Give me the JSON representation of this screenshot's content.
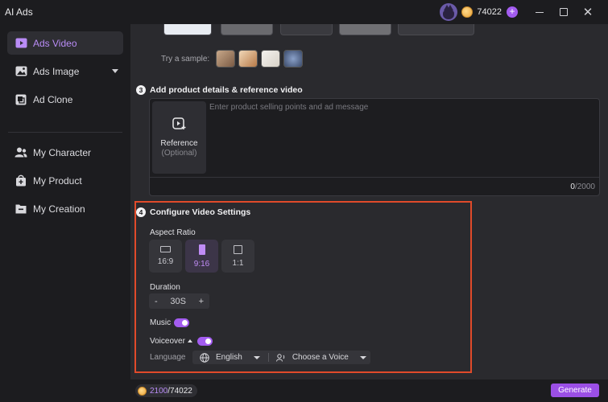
{
  "app": {
    "title": "AI Ads"
  },
  "header": {
    "credits": "74022"
  },
  "sidebar": {
    "items": [
      {
        "label": "Ads Video",
        "icon": "video-play-icon",
        "active": true
      },
      {
        "label": "Ads Image",
        "icon": "image-icon",
        "active": false
      },
      {
        "label": "Ad Clone",
        "icon": "ad-clone-icon",
        "active": false
      },
      {
        "label": "My Character",
        "icon": "character-icon",
        "active": false
      },
      {
        "label": "My Product",
        "icon": "product-icon",
        "active": false
      },
      {
        "label": "My Creation",
        "icon": "folder-icon",
        "active": false
      }
    ]
  },
  "samples": {
    "label": "Try a sample:"
  },
  "details": {
    "step_number": "3",
    "heading": "Add product details & reference video",
    "placeholder": "Enter product selling points and ad message",
    "reference_title": "Reference",
    "reference_optional": "(Optional)",
    "char_count_current": "0",
    "char_count_max": "/2000"
  },
  "config": {
    "step_number": "4",
    "heading": "Configure Video Settings",
    "aspect_ratio_label": "Aspect Ratio",
    "aspect_ratios": [
      {
        "label": "16:9",
        "selected": false
      },
      {
        "label": "9:16",
        "selected": true
      },
      {
        "label": "1:1",
        "selected": false
      }
    ],
    "duration_label": "Duration",
    "duration_minus": "-",
    "duration_value": "30S",
    "duration_plus": "+",
    "music_label": "Music",
    "music_on": true,
    "voiceover_label": "Voiceover",
    "voiceover_on": true,
    "language_label": "Language",
    "language_value": "English",
    "voice_placeholder": "Choose a Voice"
  },
  "footer": {
    "credits_used": "2100",
    "credits_total": "/74022",
    "generate_label": "Generate"
  },
  "colors": {
    "accent": "#a35cf0",
    "highlight_border": "#e04a2a",
    "panel_bg": "#2a2a2e",
    "app_bg": "#1c1c1f"
  }
}
